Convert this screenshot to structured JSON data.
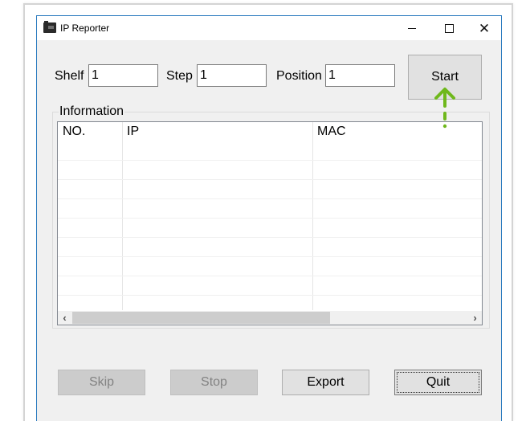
{
  "window": {
    "title": "IP Reporter",
    "icon": "app-icon",
    "caption_buttons": {
      "minimize": "minimize-icon",
      "maximize": "maximize-icon",
      "close": "close-icon"
    }
  },
  "inputs": {
    "shelf": {
      "label": "Shelf",
      "value": "1"
    },
    "step": {
      "label": "Step",
      "value": "1"
    },
    "position": {
      "label": "Position",
      "value": "1"
    }
  },
  "start_button": {
    "label": "Start"
  },
  "information": {
    "legend": "Information",
    "columns": [
      "NO.",
      "IP",
      "MAC"
    ],
    "rows": [],
    "scroll_left": "‹",
    "scroll_right": "›"
  },
  "buttons": {
    "skip": {
      "label": "Skip",
      "enabled": false
    },
    "stop": {
      "label": "Stop",
      "enabled": false
    },
    "export": {
      "label": "Export",
      "enabled": true
    },
    "quit": {
      "label": "Quit",
      "enabled": true,
      "focused": true
    }
  },
  "annotation": {
    "type": "arrow-up-dashed",
    "color": "#6fb81c",
    "target": "start_button"
  }
}
